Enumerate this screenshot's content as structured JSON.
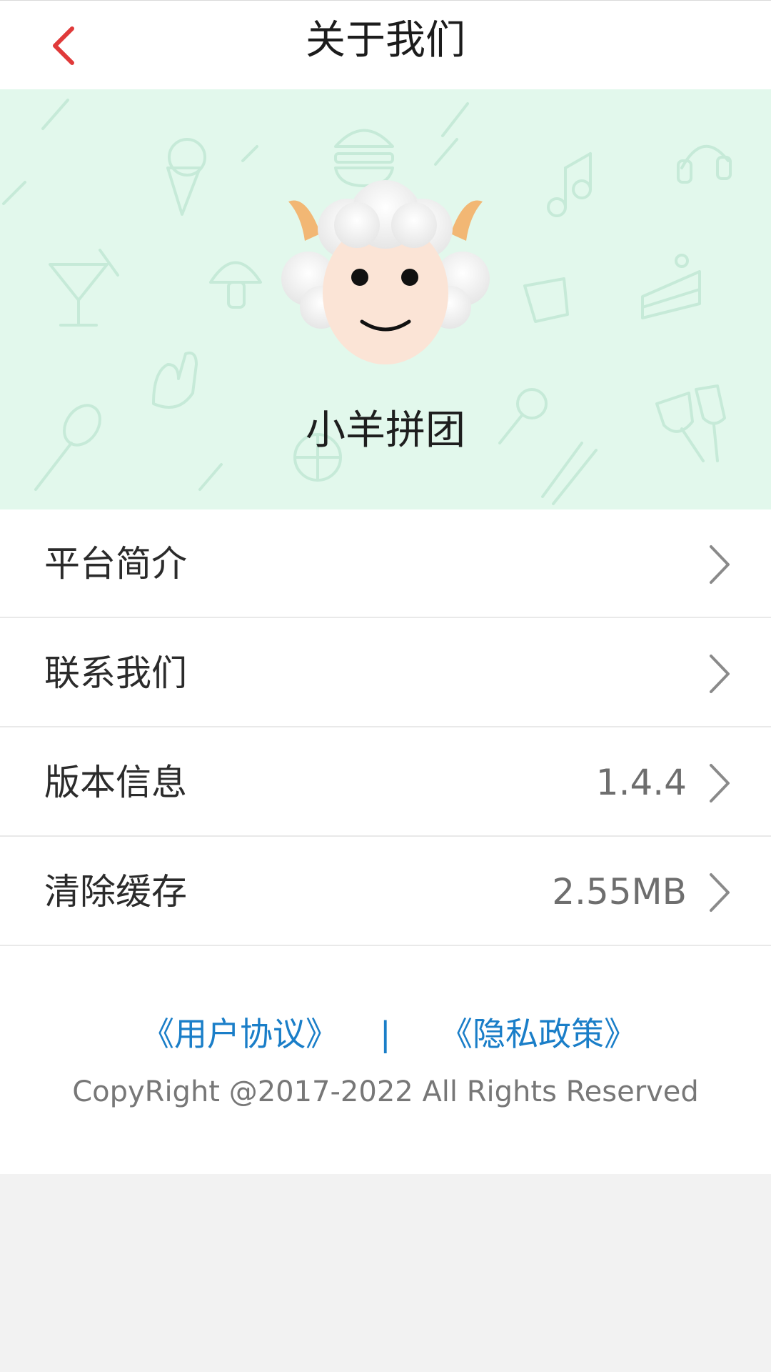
{
  "header": {
    "title": "关于我们",
    "back_icon": "chevron-left-icon",
    "accent_color": "#e03a3a"
  },
  "banner": {
    "app_name": "小羊拼团",
    "background_color": "#e2f8ec",
    "logo_icon": "sheep-logo-icon"
  },
  "menu": {
    "items": [
      {
        "label": "平台简介",
        "value": ""
      },
      {
        "label": "联系我们",
        "value": ""
      },
      {
        "label": "版本信息",
        "value": "1.4.4"
      },
      {
        "label": "清除缓存",
        "value": "2.55MB"
      }
    ]
  },
  "footer": {
    "user_agreement": "《用户协议》",
    "separator": "|",
    "privacy_policy": "《隐私政策》",
    "copyright": "CopyRight @2017-2022 All Rights Reserved",
    "link_color": "#1a7ec8"
  }
}
